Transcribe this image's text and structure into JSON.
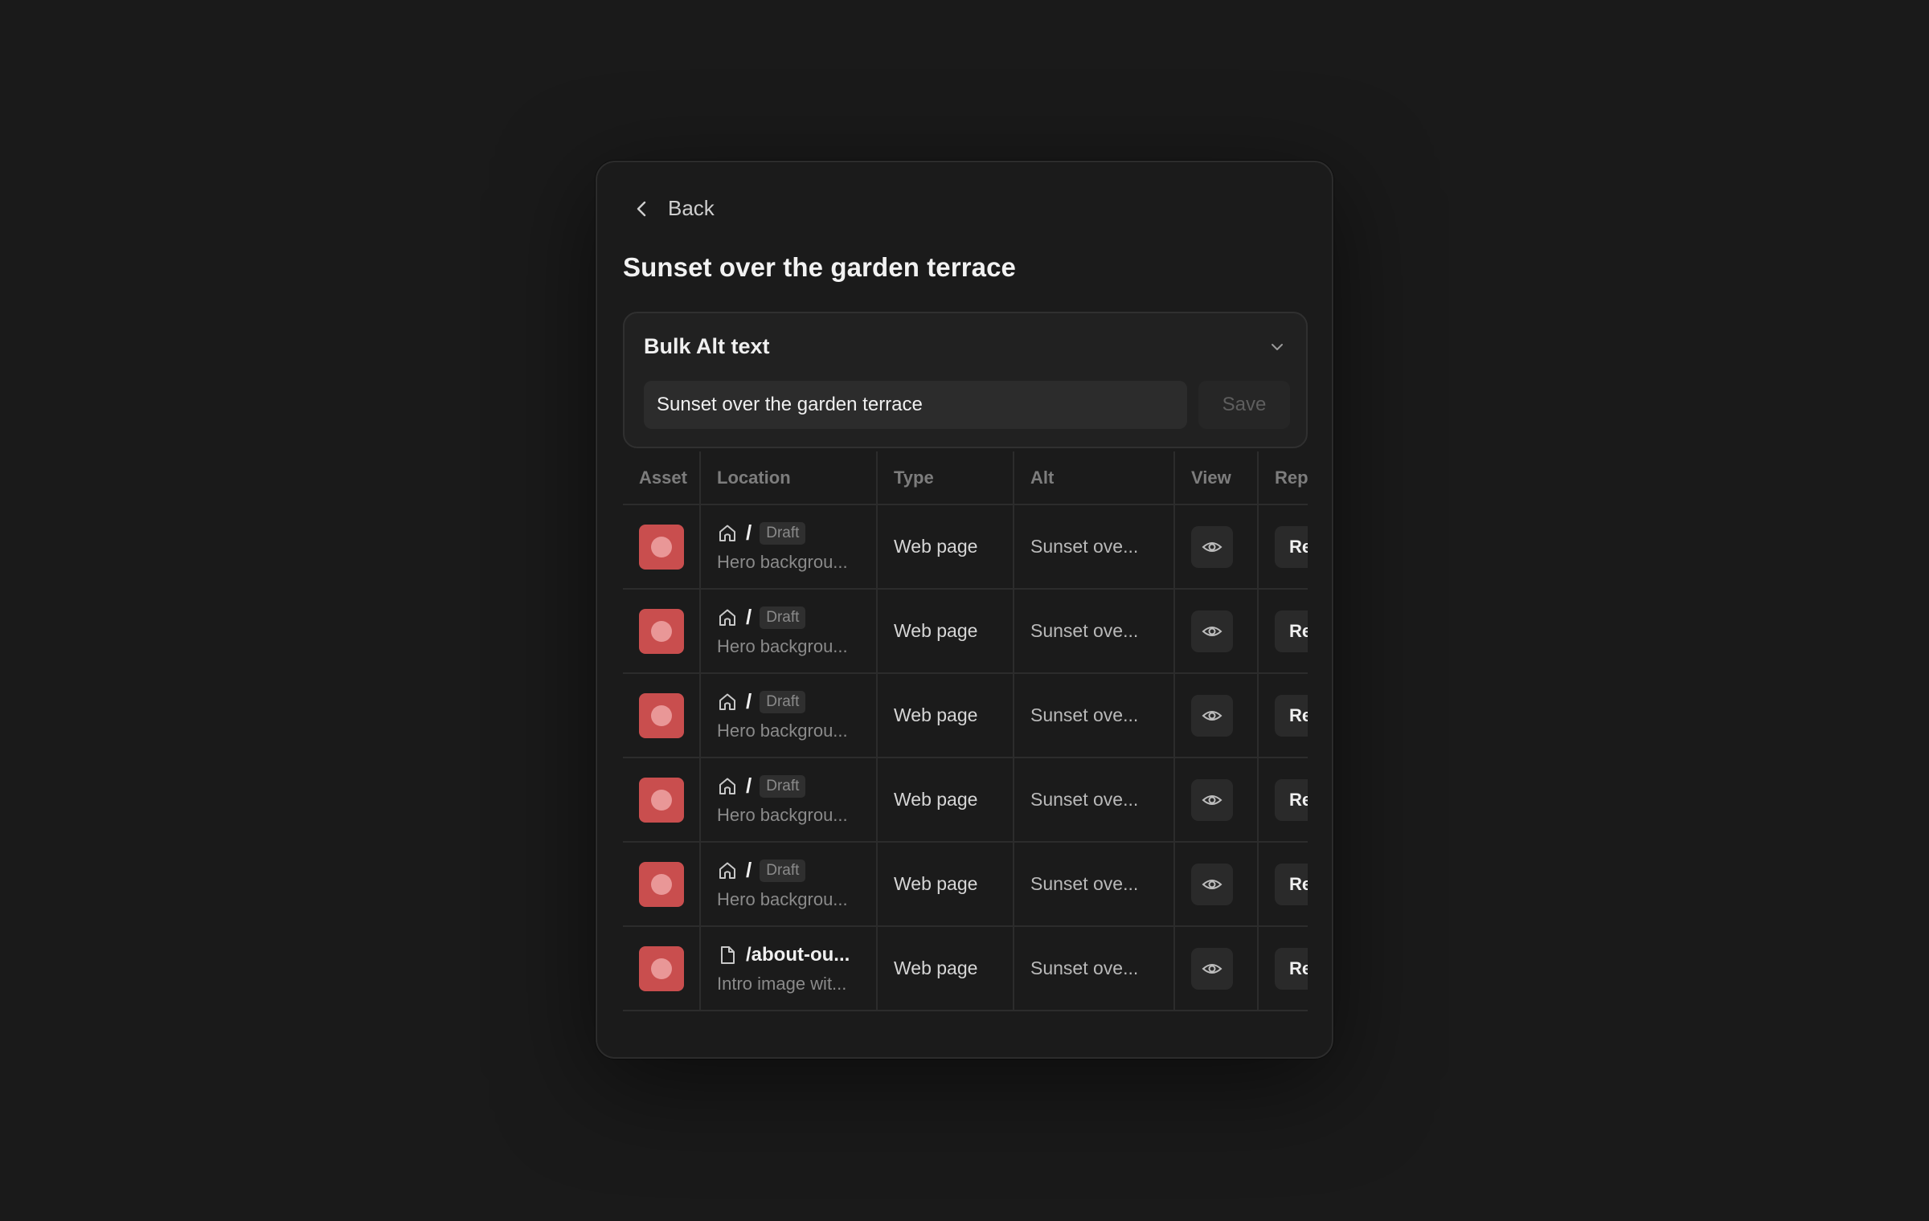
{
  "back_label": "Back",
  "title": "Sunset over the garden terrace",
  "bulk": {
    "title": "Bulk Alt text",
    "input_value": "Sunset over the garden terrace",
    "save_label": "Save"
  },
  "table": {
    "headers": [
      "Asset",
      "Location",
      "Type",
      "Alt",
      "View",
      "Rep"
    ],
    "rows": [
      {
        "loc_icon": "home-icon",
        "loc_path": "/",
        "badge": "Draft",
        "loc_sub": "Hero backgrou...",
        "type": "Web page",
        "alt": "Sunset ove...",
        "rep": "Re"
      },
      {
        "loc_icon": "home-icon",
        "loc_path": "/",
        "badge": "Draft",
        "loc_sub": "Hero backgrou...",
        "type": "Web page",
        "alt": "Sunset ove...",
        "rep": "Re"
      },
      {
        "loc_icon": "home-icon",
        "loc_path": "/",
        "badge": "Draft",
        "loc_sub": "Hero backgrou...",
        "type": "Web page",
        "alt": "Sunset ove...",
        "rep": "Re"
      },
      {
        "loc_icon": "home-icon",
        "loc_path": "/",
        "badge": "Draft",
        "loc_sub": "Hero backgrou...",
        "type": "Web page",
        "alt": "Sunset ove...",
        "rep": "Re"
      },
      {
        "loc_icon": "home-icon",
        "loc_path": "/",
        "badge": "Draft",
        "loc_sub": "Hero backgrou...",
        "type": "Web page",
        "alt": "Sunset ove...",
        "rep": "Re"
      },
      {
        "loc_icon": "page-icon",
        "loc_path": "/about-ou...",
        "badge": "",
        "loc_sub": "Intro image wit...",
        "type": "Web page",
        "alt": "Sunset ove...",
        "rep": "Re"
      }
    ]
  },
  "colors": {
    "background": "#1a1a1a",
    "panel": "#1b1b1b",
    "asset_swatch": "#c94e4e"
  }
}
